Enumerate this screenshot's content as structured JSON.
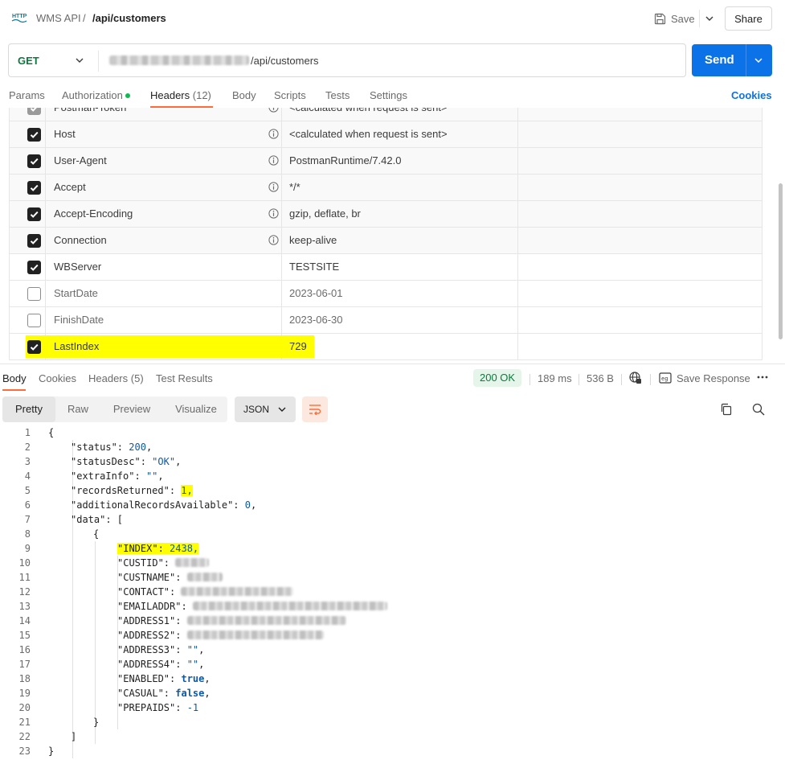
{
  "breadcrumb": {
    "collection": "WMS API",
    "separator": "/",
    "request": "/api/customers"
  },
  "toolbar": {
    "save_label": "Save",
    "share_label": "Share"
  },
  "request": {
    "method": "GET",
    "url_path": "/api/customers",
    "send_label": "Send"
  },
  "request_tabs": {
    "params": "Params",
    "authorization": "Authorization",
    "headers": "Headers",
    "headers_count": "(12)",
    "body": "Body",
    "scripts": "Scripts",
    "tests": "Tests",
    "settings": "Settings",
    "cookies": "Cookies"
  },
  "headers": [
    {
      "key": "Postman-Token",
      "value": "<calculated when request is sent>",
      "checked": true,
      "auto": true
    },
    {
      "key": "Host",
      "value": "<calculated when request is sent>",
      "checked": true,
      "auto": true
    },
    {
      "key": "User-Agent",
      "value": "PostmanRuntime/7.42.0",
      "checked": true,
      "auto": true
    },
    {
      "key": "Accept",
      "value": "*/*",
      "checked": true,
      "auto": true
    },
    {
      "key": "Accept-Encoding",
      "value": "gzip, deflate, br",
      "checked": true,
      "auto": true
    },
    {
      "key": "Connection",
      "value": "keep-alive",
      "checked": true,
      "auto": true
    },
    {
      "key": "WBServer",
      "value": "TESTSITE",
      "checked": true,
      "auto": false
    },
    {
      "key": "StartDate",
      "value": "2023-06-01",
      "checked": false,
      "auto": false
    },
    {
      "key": "FinishDate",
      "value": "2023-06-30",
      "checked": false,
      "auto": false
    },
    {
      "key": "LastIndex",
      "value": "729",
      "checked": true,
      "auto": false,
      "highlighted": true
    }
  ],
  "response_tabs": {
    "body": "Body",
    "cookies": "Cookies",
    "headers": "Headers",
    "headers_count": "(5)",
    "test_results": "Test Results"
  },
  "response_meta": {
    "status": "200 OK",
    "time": "189 ms",
    "size": "536 B",
    "save_response": "Save Response"
  },
  "view_modes": {
    "pretty": "Pretty",
    "raw": "Raw",
    "preview": "Preview",
    "visualize": "Visualize",
    "format": "JSON"
  },
  "colors": {
    "accent": "#ff6c37",
    "send": "#0c72e8",
    "method_get": "#0b7a3e",
    "highlight": "#ffff00"
  },
  "code_lines": [
    "1",
    "2",
    "3",
    "4",
    "5",
    "6",
    "7",
    "8",
    "9",
    "10",
    "11",
    "12",
    "13",
    "14",
    "15",
    "16",
    "17",
    "18",
    "19",
    "20",
    "21",
    "22",
    "23"
  ],
  "response_body": {
    "status_key": "\"status\"",
    "status_val": "200",
    "statusDesc_key": "\"statusDesc\"",
    "statusDesc_val": "\"OK\"",
    "extraInfo_key": "\"extraInfo\"",
    "extraInfo_val": "\"\"",
    "recordsReturned_key": "\"recordsReturned\"",
    "recordsReturned_val": "1,",
    "additional_key": "\"additionalRecordsAvailable\"",
    "additional_val": "0",
    "data_key": "\"data\"",
    "index_key": "\"INDEX\"",
    "index_val": "2438,",
    "custid_key": "\"CUSTID\"",
    "custname_key": "\"CUSTNAME\"",
    "contact_key": "\"CONTACT\"",
    "email_key": "\"EMAILADDR\"",
    "address1_key": "\"ADDRESS1\"",
    "address2_key": "\"ADDRESS2\"",
    "address3_key": "\"ADDRESS3\"",
    "address3_val": "\"\"",
    "address4_key": "\"ADDRESS4\"",
    "address4_val": "\"\"",
    "enabled_key": "\"ENABLED\"",
    "enabled_val": "true",
    "casual_key": "\"CASUAL\"",
    "casual_val": "false",
    "prepaids_key": "\"PREPAIDS\"",
    "prepaids_val": "-1"
  }
}
